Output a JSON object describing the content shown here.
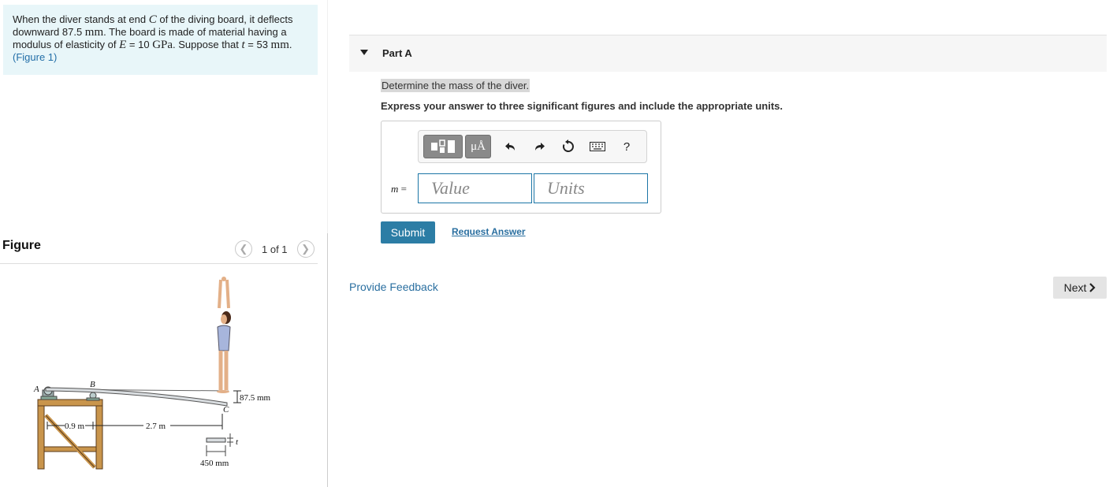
{
  "problem": {
    "text_1": "When the diver stands at end ",
    "var_c": "C",
    "text_2": " of the diving board, it deflects downward 87.5 ",
    "unit_mm": "mm",
    "text_3": ". The board is made of material having a modulus of elasticity of ",
    "var_e": "E",
    "text_4": " = 10 ",
    "unit_gpa": "GPa",
    "text_5": ". Suppose that ",
    "var_t": "t",
    "text_6": " = 53 ",
    "unit_mm2": "mm",
    "text_7": ".",
    "figure_link": "(Figure 1)"
  },
  "figure_panel": {
    "label": "Figure",
    "counter": "1 of 1",
    "prev_icon": "chevron-left-icon",
    "next_icon": "chevron-right-icon",
    "diagram": {
      "point_a": "A",
      "point_b": "B",
      "point_c": "C",
      "deflection": "87.5 mm",
      "span_ab": "0.9 m",
      "span_bc": "2.7 m",
      "thickness": "t",
      "width": "450 mm"
    }
  },
  "part": {
    "title": "Part A",
    "question": "Determine the mass of the diver.",
    "instruction": "Express your answer to three significant figures and include the appropriate units."
  },
  "toolbar": {
    "templates_icon": "templates-icon",
    "units_label": "μÅ",
    "undo_icon": "undo-icon",
    "redo_icon": "redo-icon",
    "reset_icon": "reset-icon",
    "keyboard_icon": "keyboard-icon",
    "help_label": "?"
  },
  "answer": {
    "variable": "m",
    "equals": " =",
    "value_placeholder": "Value",
    "units_placeholder": "Units"
  },
  "actions": {
    "submit": "Submit",
    "request_answer": "Request Answer",
    "provide_feedback": "Provide Feedback",
    "next": "Next"
  },
  "colors": {
    "problem_bg": "#e8f6f9",
    "link": "#2a6fa0",
    "submit_bg": "#2c7da5",
    "input_border": "#1b75a6"
  }
}
